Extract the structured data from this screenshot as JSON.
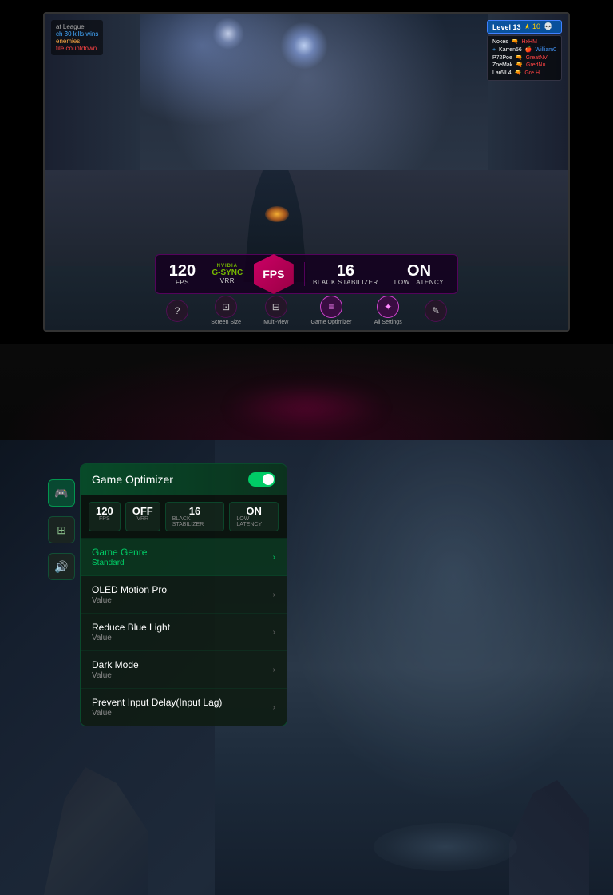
{
  "top": {
    "hud": {
      "level": "Level 13",
      "stars": "★ 10",
      "skull": "💀",
      "players": [
        {
          "name": "Nokes",
          "kill": "HxHM",
          "killColor": "red"
        },
        {
          "name": "Karren56",
          "kill": "William0",
          "killColor": "blue"
        },
        {
          "name": "P72Poe",
          "kill": "GreatNVi",
          "killColor": "red"
        },
        {
          "name": "ZoeMak",
          "kill": "GredNu.",
          "killColor": "red"
        },
        {
          "name": "Lar6IL4",
          "kill": "Gre.H",
          "killColor": "red"
        }
      ],
      "leftInfo": {
        "title": "at League",
        "score": "ch 30 kills wins",
        "enemies": "enemies",
        "countdown": "tile countdown"
      }
    },
    "scoreStrip": {
      "fps": "120",
      "fpsLabel": "FPS",
      "gsyncNvidia": "NVIDIA",
      "gsyncText": "G-SYNC",
      "gsyncSubLabel": "VRR",
      "fpsBadge": "FPS",
      "blackStabilizer": "16",
      "blackStabilizerLabel": "Black Stabilizer",
      "lowLatency": "ON",
      "lowLatencyLabel": "Low Latency"
    },
    "toolbar": {
      "items": [
        {
          "icon": "?",
          "label": ""
        },
        {
          "icon": "⊡",
          "label": "Screen Size"
        },
        {
          "icon": "⊟",
          "label": "Multi-view"
        },
        {
          "icon": "≡",
          "label": "Game Optimizer"
        },
        {
          "icon": "✦",
          "label": "All Settings"
        },
        {
          "icon": "✎",
          "label": ""
        }
      ]
    }
  },
  "bottom": {
    "sidebarIcons": [
      {
        "icon": "🎮",
        "label": "gamepad-icon",
        "active": true
      },
      {
        "icon": "⊞",
        "label": "grid-icon",
        "active": false
      },
      {
        "icon": "🔊",
        "label": "volume-icon",
        "active": false
      }
    ],
    "panel": {
      "title": "Game Optimizer",
      "toggleOn": true,
      "stats": [
        {
          "value": "120",
          "label": "FPS"
        },
        {
          "value": "OFF",
          "label": "VRR"
        },
        {
          "value": "16",
          "label": "Black Stabilizer"
        },
        {
          "value": "ON",
          "label": "Low Latency"
        }
      ],
      "menuItems": [
        {
          "name": "Game Genre",
          "value": "Standard",
          "valueColor": "green",
          "active": true
        },
        {
          "name": "OLED Motion Pro",
          "value": "Value",
          "valueColor": "gray",
          "active": false
        },
        {
          "name": "Reduce Blue Light",
          "value": "Value",
          "valueColor": "gray",
          "active": false
        },
        {
          "name": "Dark Mode",
          "value": "Value",
          "valueColor": "gray",
          "active": false
        },
        {
          "name": "Prevent Input Delay(Input Lag)",
          "value": "Value",
          "valueColor": "gray",
          "active": false
        }
      ]
    }
  }
}
